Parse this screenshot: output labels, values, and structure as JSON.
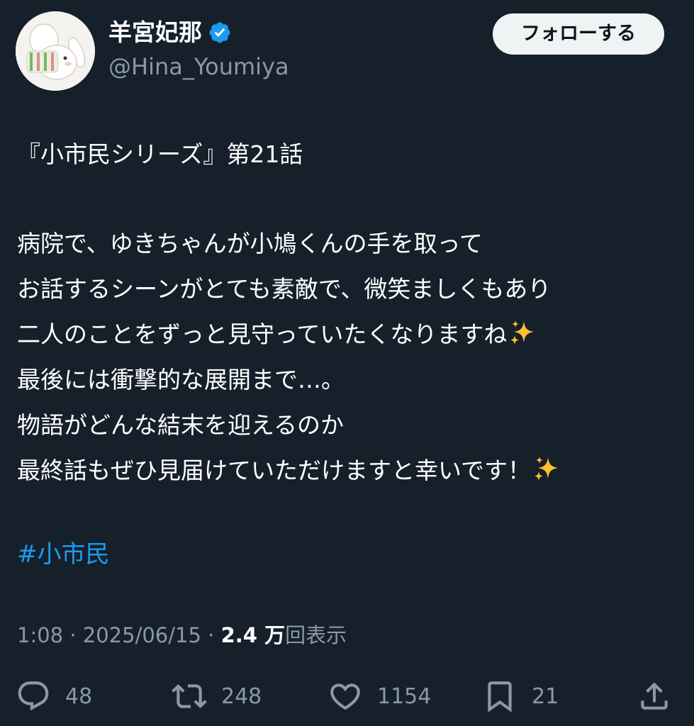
{
  "author": {
    "display_name": "羊宮妃那",
    "handle": "@Hina_Youmiya",
    "verified": true
  },
  "follow_button_label": "フォローする",
  "tweet": {
    "lines": [
      "『小市民シリーズ』第21話",
      "",
      "病院で、ゆきちゃんが小鳩くんの手を取って",
      "お話するシーンがとても素敵で、微笑ましくもあり",
      "二人のことをずっと見守っていたくなりますね",
      "最後には衝撃的な展開まで…。",
      "物語がどんな結末を迎えるのか",
      "最終話もぜひ見届けていただけますと幸いです！"
    ],
    "hashtag": "#小市民"
  },
  "meta": {
    "time": "1:08",
    "separator": "·",
    "date": "2025/06/15",
    "views_count": "2.4 万",
    "views_label": "回表示"
  },
  "actions": {
    "replies": "48",
    "retweets": "248",
    "likes": "1154",
    "bookmarks": "21"
  },
  "colors": {
    "background": "#15202b",
    "text": "#ffffff",
    "secondary_text": "#8b98a5",
    "link": "#1d9bf0",
    "verified_badge": "#1d9bf0",
    "follow_button_bg": "#eff3f4"
  }
}
